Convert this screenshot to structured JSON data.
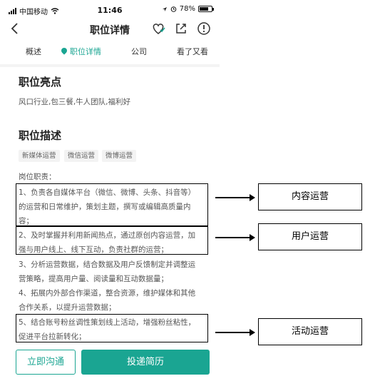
{
  "status_bar": {
    "carrier": "中国移动",
    "time": "11:46",
    "battery": "78%",
    "battery_level": 0.78
  },
  "header": {
    "title": "职位详情",
    "back_icon": "chevron-left-icon",
    "icons": [
      "heart-check-icon",
      "share-icon",
      "report-icon"
    ]
  },
  "tabs": [
    "概述",
    "职位详情",
    "公司",
    "看了又看"
  ],
  "highlights": {
    "heading": "职位亮点",
    "text": "风口行业,包三餐,牛人团队,福利好"
  },
  "description": {
    "heading": "职位描述",
    "tags": [
      "新媒体运营",
      "微信运营",
      "微博运营"
    ],
    "lines": [
      "岗位职责：",
      "1、负责各自媒体平台（微信、微博、头条、抖音等）",
      "的运营和日常维护，策划主题，撰写或编辑高质量内",
      "容；",
      "2、及时掌握并利用新闻热点，通过原创内容运营，加",
      "强与用户线上、线下互动，负责社群的运营；",
      "3、分析运营数据，结合数据及用户反馈制定并调整运",
      "营策略，提高用户量、阅读量和互动数据量；",
      "4、拓展内外部合作渠道，整合资源，维护媒体和其他",
      "合作关系，以提升运营数据；",
      "5、结合账号粉丝调性策划线上活动，增强粉丝粘性，",
      "促进平台拉新转化；"
    ]
  },
  "actions": {
    "chat": "立即沟通",
    "apply": "投递简历"
  },
  "annotations": [
    "内容运营",
    "用户运营",
    "活动运营"
  ],
  "colors": {
    "accent": "#1aa592"
  }
}
